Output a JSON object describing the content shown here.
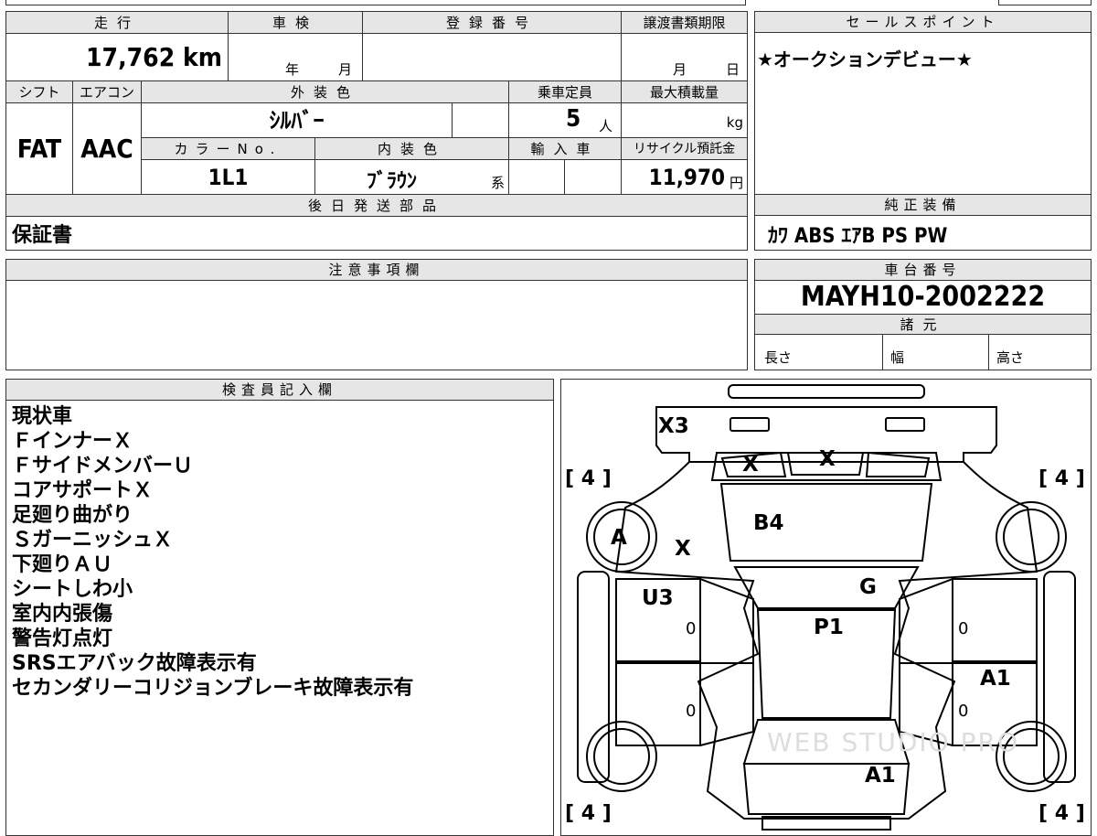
{
  "vehicle": {
    "mileage_header": "走行",
    "mileage_value": "17,762 km",
    "inspection_header": "車検",
    "inspection_year_unit": "年",
    "inspection_month_unit": "月",
    "registration_header": "登録番号",
    "transfer_deadline_header": "譲渡書類期限",
    "transfer_month_unit": "月",
    "transfer_day_unit": "日",
    "shift_header": "シフト",
    "shift_value": "FAT",
    "aircon_header": "エアコン",
    "aircon_value": "AAC",
    "exterior_color_header": "外装色",
    "exterior_color_value": "ｼﾙﾊﾞｰ",
    "capacity_header": "乗車定員",
    "capacity_value": "5",
    "capacity_unit": "人",
    "max_load_header": "最大積載量",
    "max_load_unit": "kg",
    "color_no_header": "カラーNo.",
    "color_no_value": "1L1",
    "interior_color_header": "内装色",
    "interior_color_value": "ﾌﾞﾗｳﾝ",
    "interior_color_suffix": "系",
    "import_header": "輸入車",
    "recycle_header": "リサイクル預託金",
    "recycle_value": "11,970",
    "recycle_unit": "円",
    "later_parts_header": "後日発送部品",
    "later_parts_value": "保証書"
  },
  "sales_point": {
    "header": "セールスポイント",
    "text": "★オークションデビュー★"
  },
  "equipment": {
    "header": "純正装備",
    "value": "ｶﾜ ABS ｴｱB PS PW"
  },
  "notes": {
    "header": "注意事項欄",
    "text": ""
  },
  "chassis": {
    "header": "車台番号",
    "value": "MAYH10-2002222",
    "spec_header": "諸元",
    "length_label": "長さ",
    "width_label": "幅",
    "height_label": "高さ"
  },
  "inspector": {
    "header": "検査員記入欄",
    "lines": [
      "現状車",
      "ＦインナーＸ",
      "ＦサイドメンバーＵ",
      "コアサポートＸ",
      "足廻り曲がり",
      "ＳガーニッシュＸ",
      "下廻りＡＵ",
      "シートしわ小",
      "室内内張傷",
      "警告灯点灯",
      "SRSエアバック故障表示有",
      "セカンダリーコリジョンブレーキ故障表示有"
    ]
  },
  "diagram": {
    "marks": {
      "front_bumper": "X3",
      "left_headlight": "X",
      "right_headlight": "X",
      "hood": "B4",
      "front_left_wheel_mark": "A",
      "left_fender": "X",
      "windshield": "G",
      "front_left_door": "U3",
      "roof": "P1",
      "rear_right_door": "A1",
      "trunk": "A1"
    },
    "tire_tl": "4",
    "tire_tr": "4",
    "tire_bl": "4",
    "tire_br": "4",
    "zero_1": "0",
    "zero_2": "0",
    "zero_3": "0",
    "zero_4": "0",
    "watermark": "WEB STUDIO PRO"
  }
}
